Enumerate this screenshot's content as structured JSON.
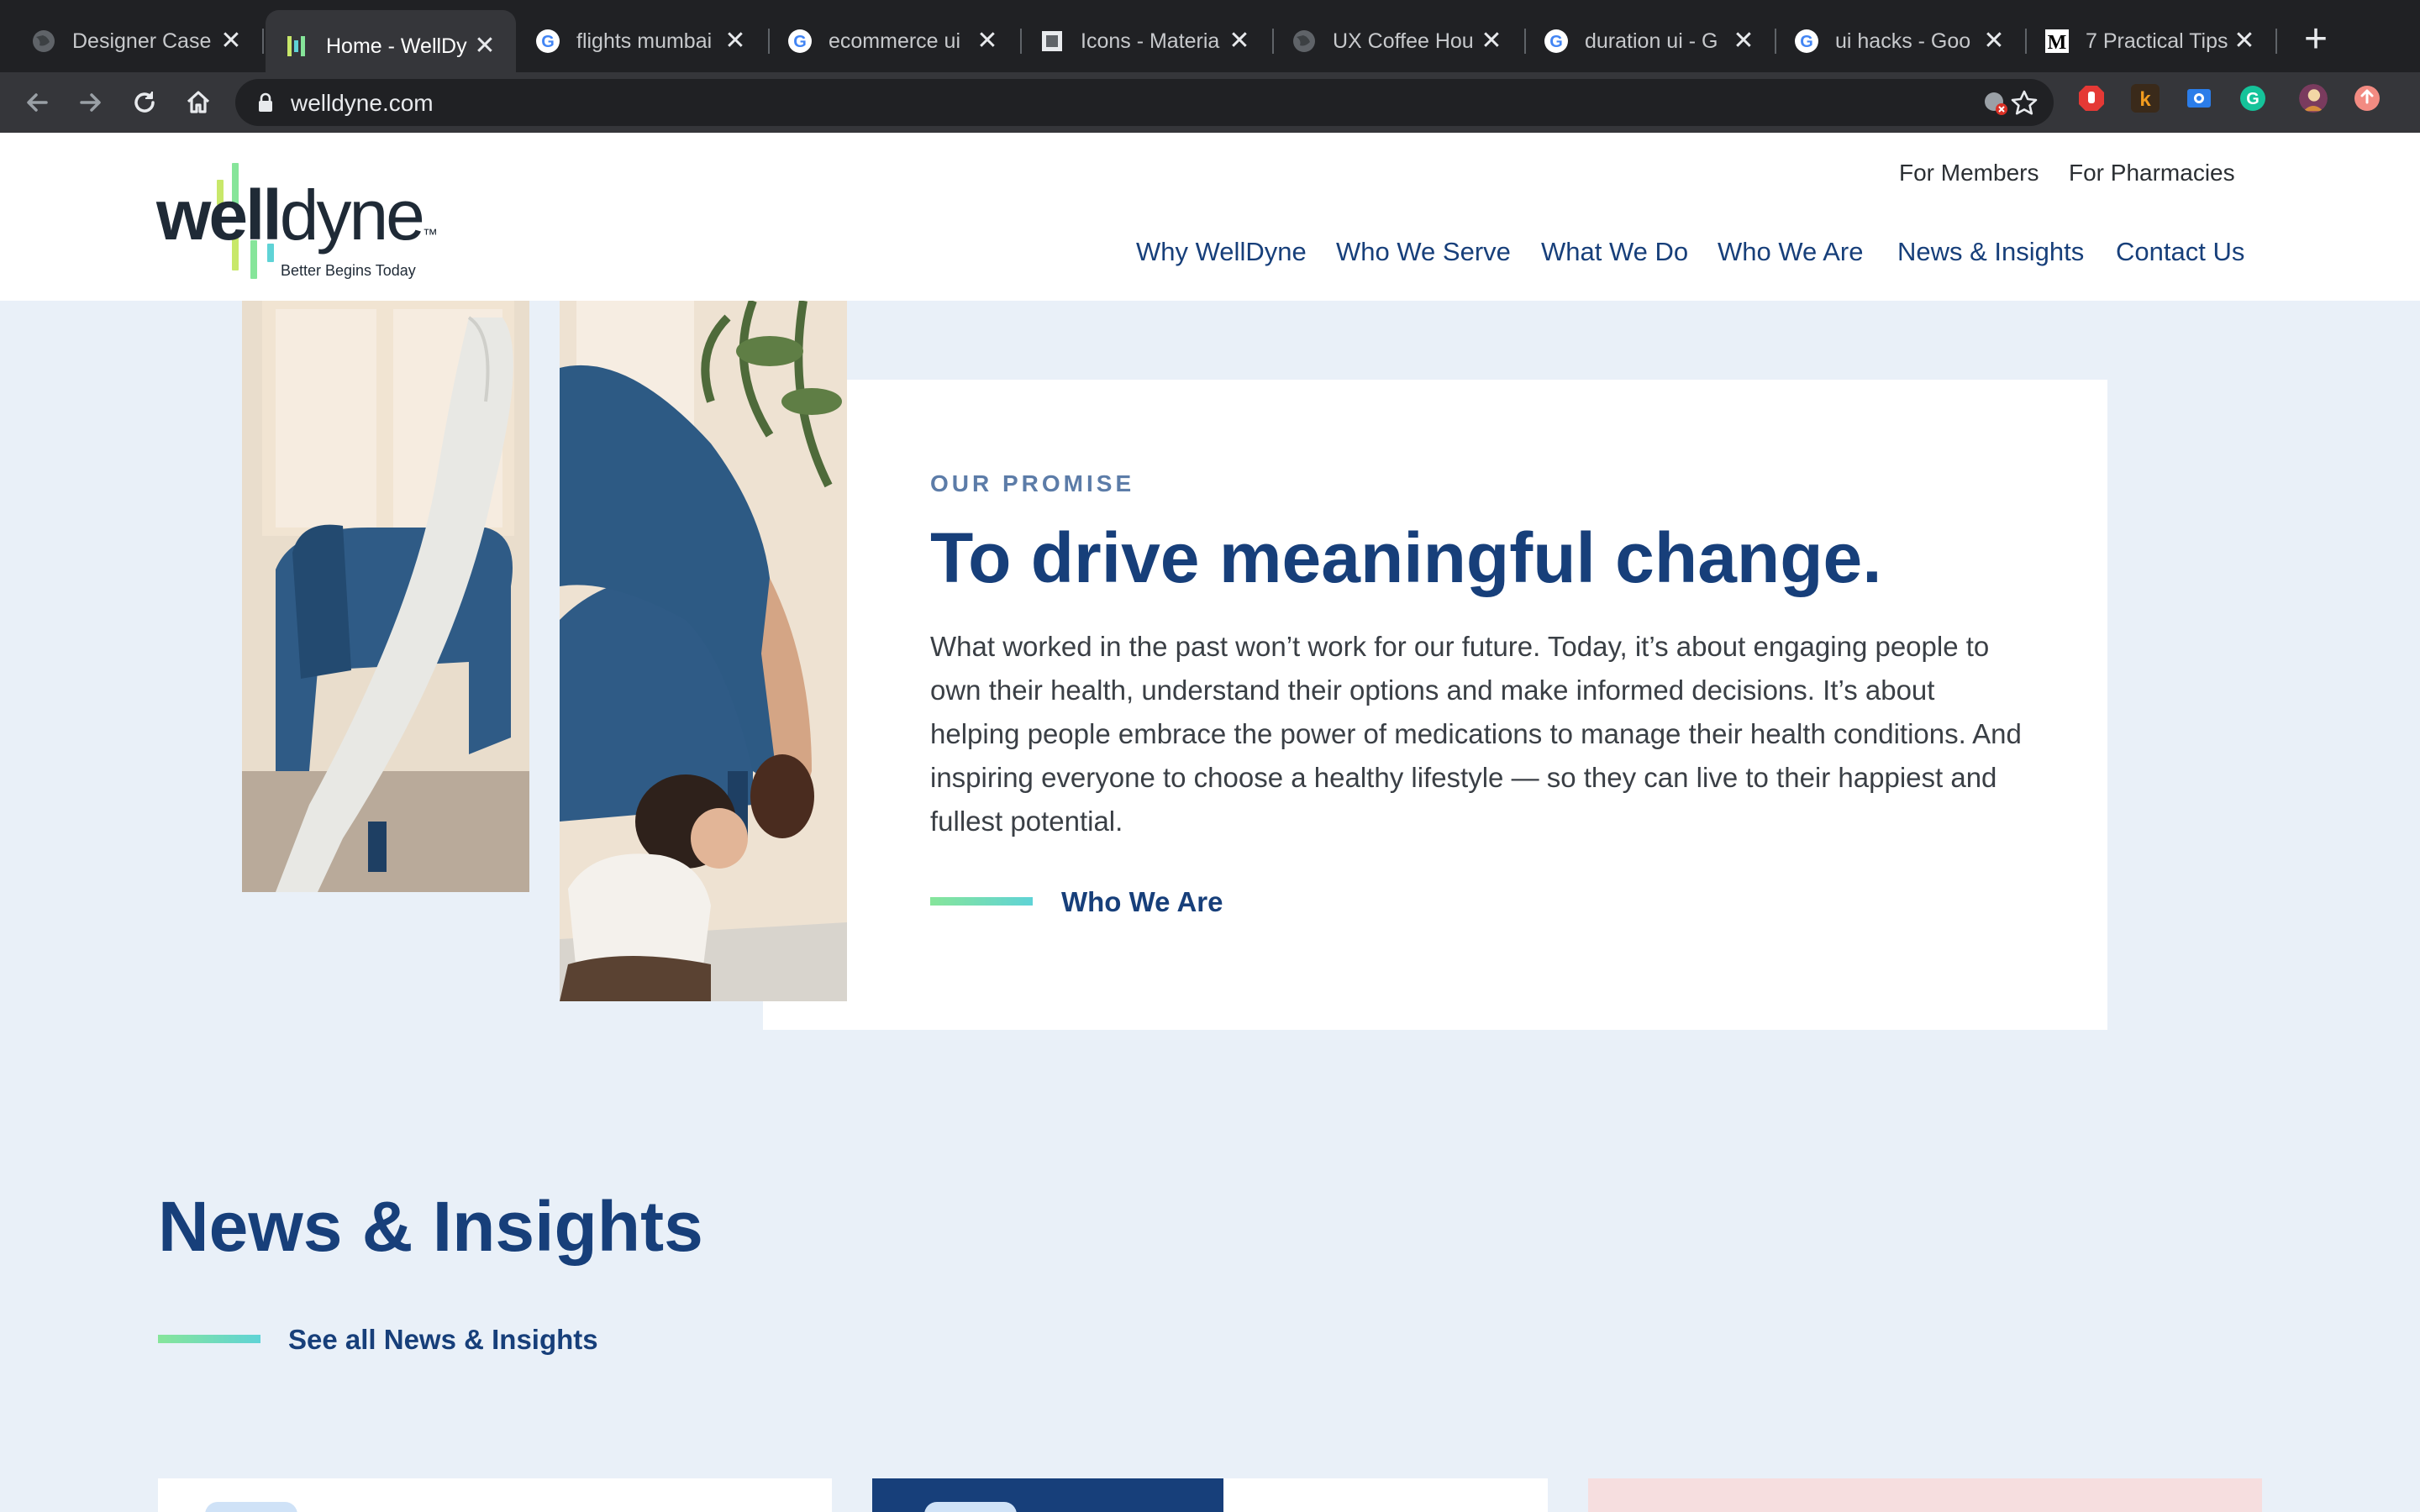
{
  "browser": {
    "tabs": [
      {
        "title": "Designer Case",
        "favicon": "globe-icon",
        "active": false
      },
      {
        "title": "Home - WellDy",
        "favicon": "welldyne-favicon",
        "active": true
      },
      {
        "title": "flights mumbai",
        "favicon": "google-icon",
        "active": false
      },
      {
        "title": "ecommerce ui",
        "favicon": "google-icon",
        "active": false
      },
      {
        "title": "Icons - Materia",
        "favicon": "material-icon",
        "active": false
      },
      {
        "title": "UX Coffee Hou",
        "favicon": "globe-icon",
        "active": false
      },
      {
        "title": "duration ui - G",
        "favicon": "google-icon",
        "active": false
      },
      {
        "title": "ui hacks - Goo",
        "favicon": "google-icon",
        "active": false
      },
      {
        "title": "7 Practical Tips",
        "favicon": "medium-icon",
        "active": false
      }
    ],
    "close_glyph": "✕",
    "new_tab_glyph": "+",
    "url": "welldyne.com"
  },
  "site": {
    "logo": {
      "word_bold": "well",
      "word_light": "dyne",
      "tm": "™",
      "tagline": "Better Begins Today"
    },
    "utility_nav": [
      "For Members",
      "For Pharmacies"
    ],
    "main_nav": [
      "Why WellDyne",
      "Who We Serve",
      "What We Do",
      "Who We Are",
      "News & Insights",
      "Contact Us"
    ]
  },
  "promise": {
    "eyebrow": "OUR PROMISE",
    "headline": "To drive meaningful change.",
    "body": "What worked in the past won’t work for our future. Today, it’s about engaging people to own their health, understand their options and make informed decisions. It’s about helping people embrace the power of medications to manage their health conditions. And inspiring everyone to choose a healthy lifestyle — so they can live to their happiest and fullest potential.",
    "cta": "Who We Are"
  },
  "news": {
    "title": "News & Insights",
    "cta": "See all News & Insights"
  },
  "colors": {
    "brand_navy": "#173f7a",
    "accent_green": "#86e59a",
    "accent_teal": "#5fd3d6",
    "page_bg": "#e9f0f8"
  }
}
